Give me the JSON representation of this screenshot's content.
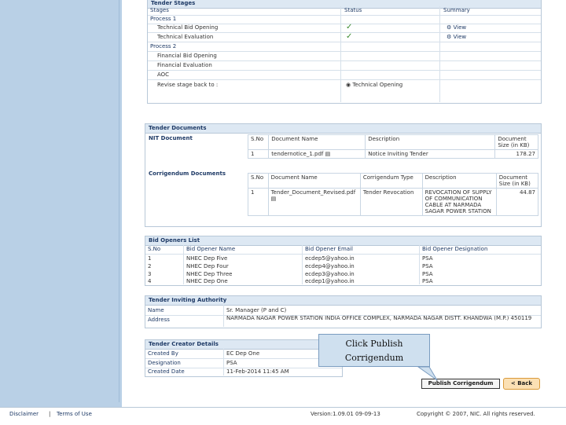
{
  "tender_stages": {
    "header": "Tender Stages",
    "col_stages": "Stages",
    "col_status": "Status",
    "col_summary": "Summary",
    "process1": "Process 1",
    "tech_bid_opening": "Technical Bid Opening",
    "tech_evaluation": "Technical Evaluation",
    "view1": "View",
    "view2": "View",
    "process2": "Process 2",
    "fin_bid_opening": "Financial Bid Opening",
    "fin_evaluation": "Financial Evaluation",
    "aoc": "AOC",
    "revise_label": "Revise stage back to :",
    "revise_option": "Technical Opening"
  },
  "tender_documents": {
    "header": "Tender Documents",
    "nit_label": "NIT Document",
    "nit_cols": [
      "S.No",
      "Document Name",
      "Description",
      "Document Size (in KB)"
    ],
    "nit_rows": [
      [
        "1",
        "tendernotice_1.pdf",
        "Notice Inviting Tender",
        "178.27"
      ]
    ],
    "corr_label": "Corrigendum Documents",
    "corr_cols": [
      "S.No",
      "Document Name",
      "Corrigendum Type",
      "Description",
      "Document Size (in KB)"
    ],
    "corr_rows": [
      [
        "1",
        "Tender_Document_Revised.pdf",
        "Tender Revocation",
        "REVOCATION OF SUPPLY OF COMMUNICATION CABLE AT NARMADA SAGAR POWER STATION",
        "44.87"
      ]
    ]
  },
  "bid_openers": {
    "header": "Bid Openers List",
    "cols": [
      "S.No",
      "Bid Opener Name",
      "Bid Opener Email",
      "Bid Opener Designation"
    ],
    "rows": [
      [
        "1",
        "NHEC Dep Five",
        "ecdep5@yahoo.in",
        "PSA"
      ],
      [
        "2",
        "NHEC Dep Four",
        "ecdep4@yahoo.in",
        "PSA"
      ],
      [
        "3",
        "NHEC Dep Three",
        "ecdep3@yahoo.in",
        "PSA"
      ],
      [
        "4",
        "NHEC Dep One",
        "ecdep1@yahoo.in",
        "PSA"
      ]
    ]
  },
  "tender_authority": {
    "header": "Tender Inviting Authority",
    "name_label": "Name",
    "name_value": "Sr. Manager (P and C)",
    "address_label": "Address",
    "address_value": "NARMADA NAGAR POWER STATION INDIA OFFICE COMPLEX, NARMADA NAGAR DISTT. KHANDWA (M.P.) 450119"
  },
  "tender_creator": {
    "header": "Tender Creator Details",
    "created_by_label": "Created By",
    "created_by_value": "EC Dep One",
    "designation_label": "Designation",
    "designation_value": "PSA",
    "created_date_label": "Created Date",
    "created_date_value": "11-Feb-2014 11:45 AM"
  },
  "buttons": {
    "publish": "Publish Corrigendum",
    "back": "< Back"
  },
  "callout": {
    "line1": "Click Publish",
    "line2": "Corrigendum"
  },
  "footer": {
    "disclaimer": "Disclaimer",
    "separator": "|",
    "terms": "Terms of Use",
    "version": "Version:1.09.01 09-09-13",
    "copyright": "Copyright © 2007, NIC. All rights reserved."
  }
}
